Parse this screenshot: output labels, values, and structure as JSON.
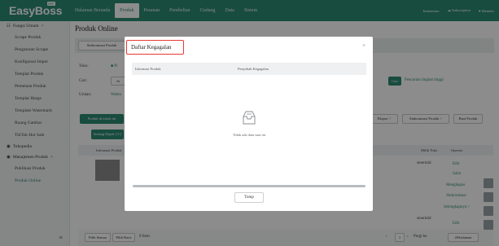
{
  "app": {
    "logo": "EasyBoss",
    "logo_sup": "ERP"
  },
  "nav": {
    "items": [
      "Halaman Beranda",
      "Produk",
      "Pesanan",
      "Pembelian",
      "Gudang",
      "Data",
      "Sistem"
    ]
  },
  "topright": {
    "language": "Indonesian",
    "subscription": "Subscription",
    "user": "Member"
  },
  "sidebar": {
    "section1": "Fungsi Umum",
    "items1": [
      "Scrape Produk",
      "Pengaturan Scrape",
      "Konfigurasi Impor",
      "Templat Produk",
      "Pemetaan Produk",
      "Templat Harga",
      "Template Watermark",
      "Ruang Gambar",
      "TikTok Hot Sale"
    ],
    "section2": "Tokopedia",
    "section3": "Manajemen Produk",
    "items3": [
      "Publikasi Produk",
      "Produk Online"
    ]
  },
  "page": {
    "title": "Produk Online",
    "sync_tab": "Sinkronisasi Produk",
    "filter_toko": "Toko:",
    "filter_cari": "Cari:",
    "filter_urutan": "Urutan:",
    "filter_waktu": "Waktu",
    "filter_opt": "Pi",
    "cari_button": "Cari",
    "advanced_search": "Pencarian tingkat tinggi",
    "btn_produk": "Produk di tokoh ini",
    "ekspor": "Ekspor",
    "sinkronisasi_btn": "Sinkronisasi Produk",
    "buat_produk": "Buat Produk",
    "status_tab": "Sedang Dijual ( 6 )",
    "col_info": "Informasi Produk",
    "col_toko": "Milik Toko",
    "col_operasi": "Operasi",
    "store_name_1": "stoermid",
    "store_name_2": "stoermid",
    "actions": [
      "Edit",
      "Salin",
      "Menghapus",
      "Sinkronisasi",
      "Selengkapnya"
    ],
    "edit2": "Edit",
    "select_all": "Pilih Semua",
    "pilih_baris": "Pilih Baris",
    "items_count": "0 Item",
    "page_label": "Pergi ke",
    "page_number": "1",
    "per_page": "20/halaman"
  },
  "modal": {
    "title": "Daftar Kegagalan",
    "col_info": "Informasi Produk",
    "col_reason": "Penyebab Kegagalan",
    "empty_text": "Tidak ada data saat ini",
    "close_button": "Tutup"
  },
  "colors": {
    "brand": "#2d8a74",
    "highlight": "#e53935"
  }
}
